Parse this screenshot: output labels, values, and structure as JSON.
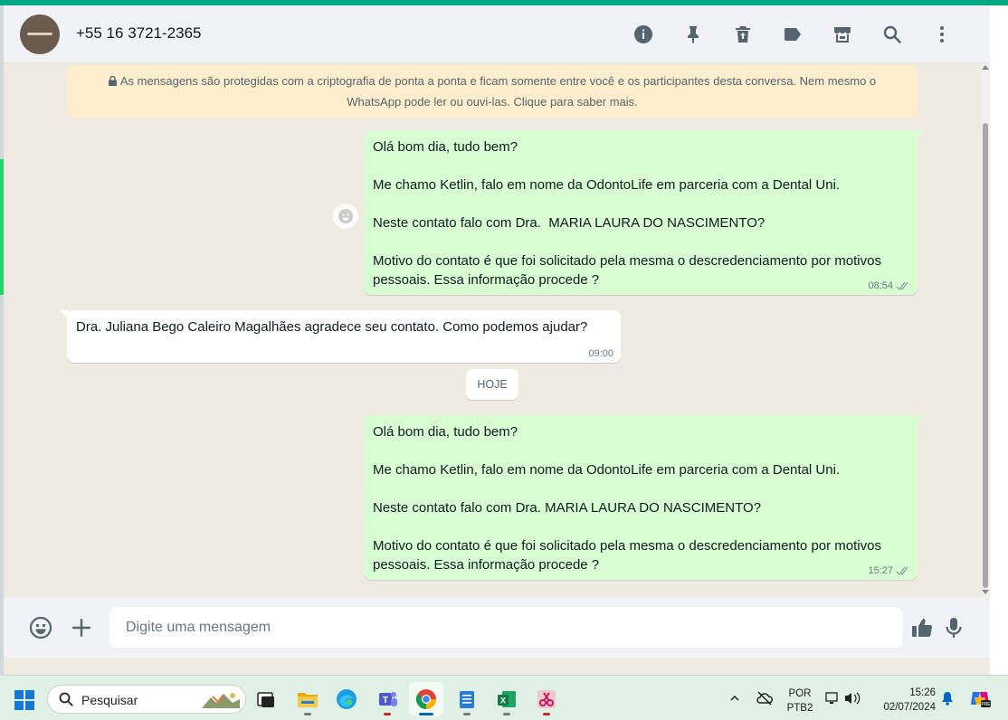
{
  "header": {
    "contact_name": "+55 16 3721-2365",
    "icons": [
      "info-icon",
      "pin-icon",
      "delete-icon",
      "label-icon",
      "store-icon",
      "search-icon",
      "menu-icon"
    ]
  },
  "encryption_notice": "As mensagens são protegidas com a criptografia de ponta a ponta e ficam somente entre você e os participantes desta conversa. Nem mesmo o WhatsApp pode ler ou ouvi-las. Clique para saber mais.",
  "messages": [
    {
      "direction": "out",
      "lines": [
        "Olá bom dia, tudo bem?",
        "Me chamo Ketlin, falo em nome da OdontoLife em parceria com a Dental Uni.",
        "Neste contato falo com Dra.  MARIA LAURA DO NASCIMENTO?",
        "Motivo do contato é que foi solicitado pela mesma o descredenciamento por motivos pessoais. Essa informação procede ?"
      ],
      "time": "08:54",
      "status": "read"
    },
    {
      "direction": "in",
      "lines": [
        "Dra. Juliana Bego Caleiro Magalhães agradece seu contato. Como podemos ajudar?"
      ],
      "time": "09:00"
    },
    {
      "direction": "out",
      "lines": [
        "Olá bom dia, tudo bem?",
        "Me chamo Ketlin, falo em nome da OdontoLife em parceria com a Dental Uni.",
        "Neste contato falo com Dra. MARIA LAURA DO NASCIMENTO?",
        "Motivo do contato é que foi solicitado pela mesma o descredenciamento por motivos pessoais. Essa informação procede ?"
      ],
      "time": "15:27",
      "status": "read"
    }
  ],
  "date_divider": "HOJE",
  "composer": {
    "placeholder": "Digite uma mensagem"
  },
  "taskbar": {
    "search_label": "Pesquisar",
    "language": "POR",
    "keyboard": "PTB2",
    "time": "15:26",
    "date": "02/07/2024"
  },
  "colors": {
    "accent": "#00a884",
    "outgoing_bubble": "#d9fdd3",
    "notice_bg": "#ffeecd",
    "read_ticks": "#8696a0"
  }
}
